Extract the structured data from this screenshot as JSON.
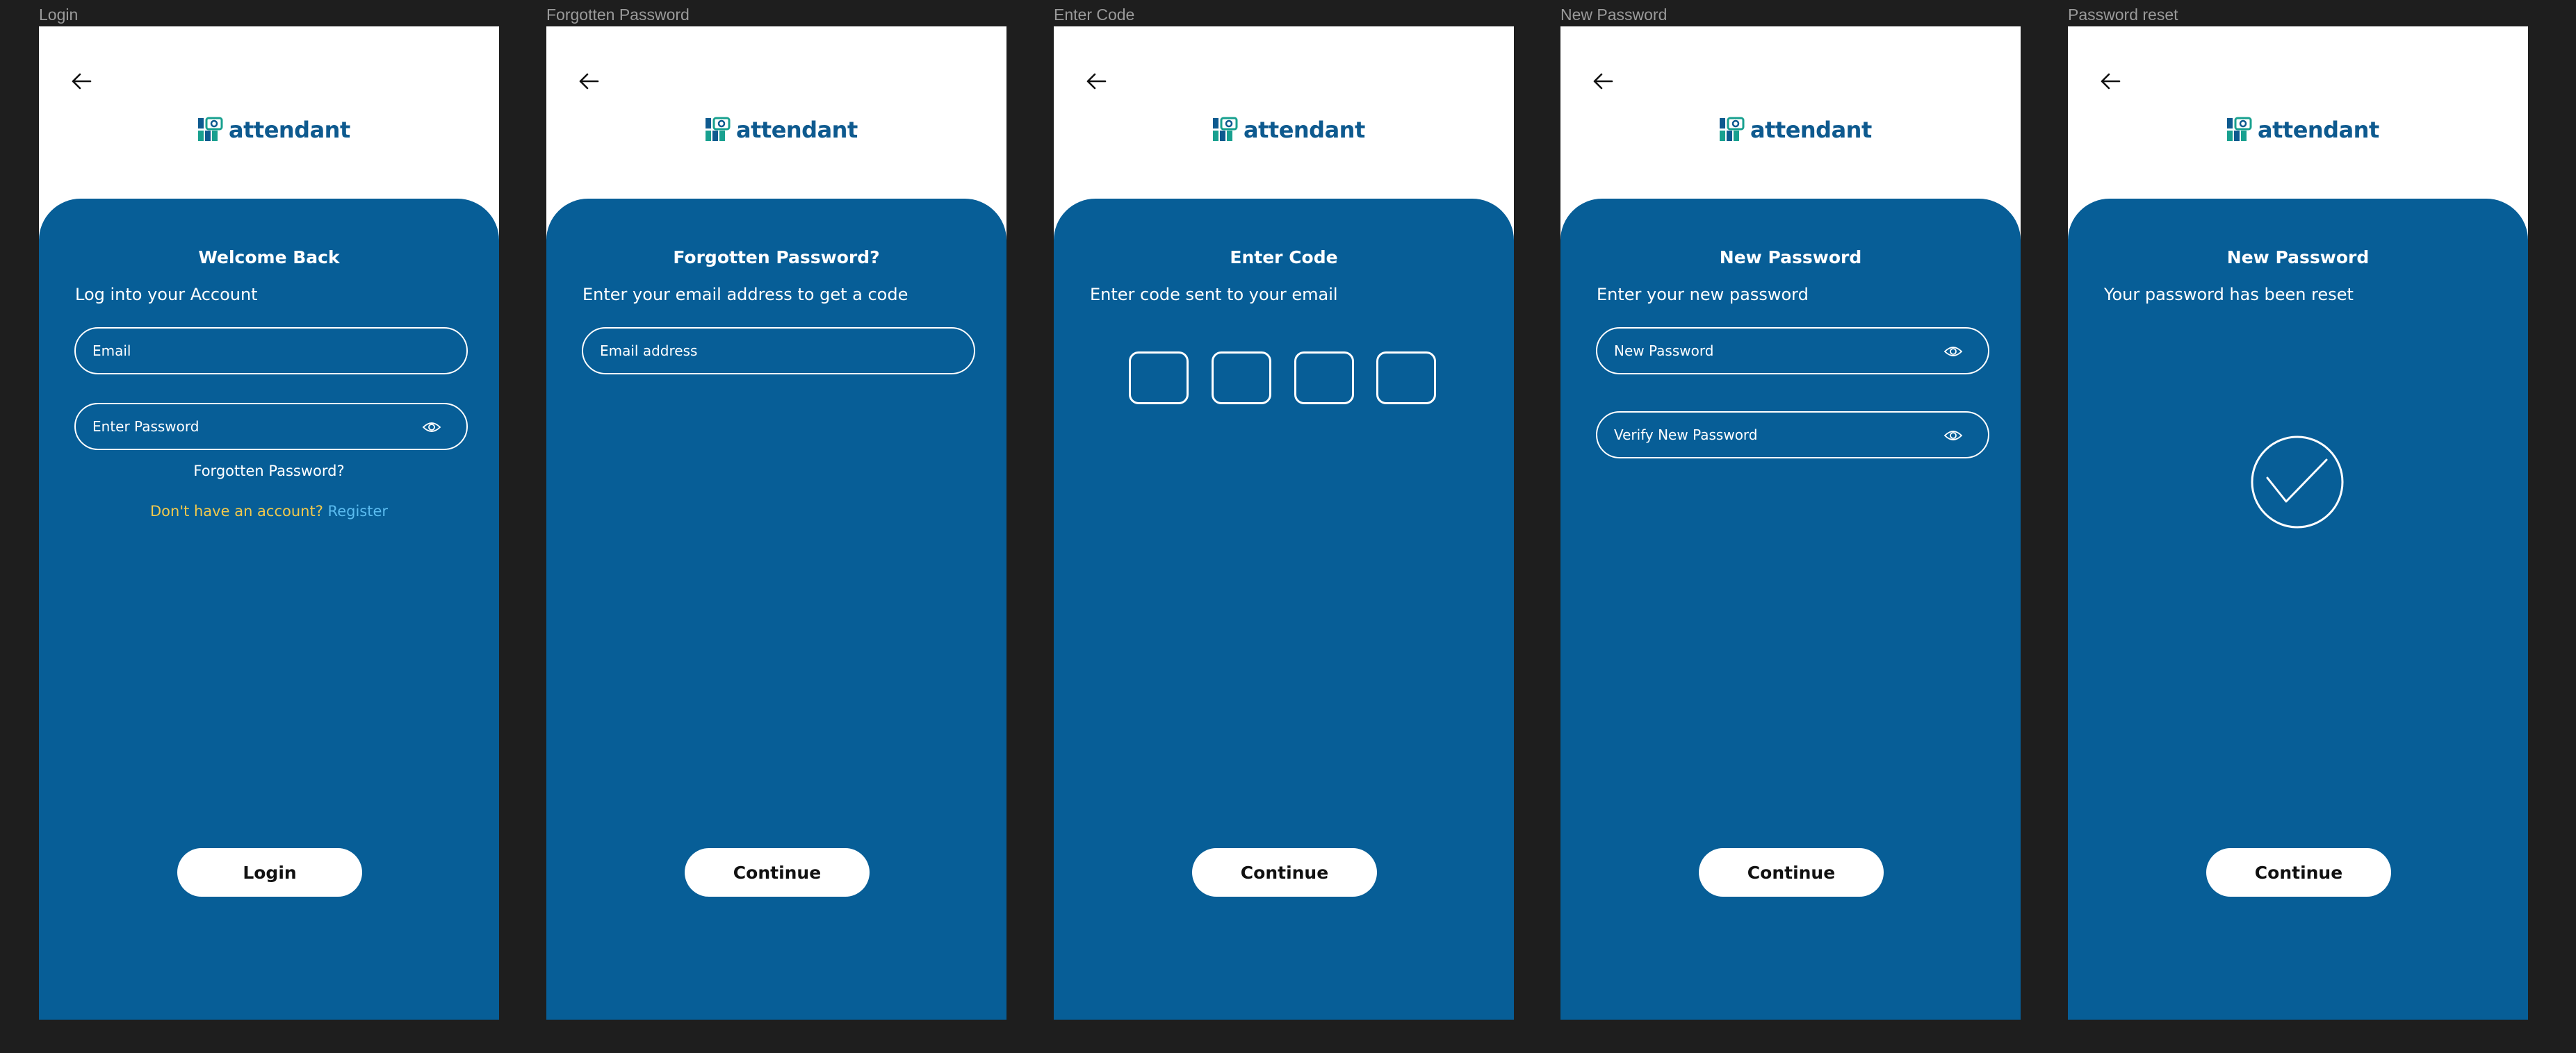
{
  "brand": {
    "name": "attendant",
    "color": "#0e5a8f",
    "panel_color": "#075e97"
  },
  "frames": [
    {
      "label": "Login",
      "title": "Welcome Back",
      "subtitle": "Log into your Account",
      "email_placeholder": "Email",
      "password_placeholder": "Enter Password",
      "forgot_link": "Forgotten Password?",
      "register_prompt": "Don't have an account?",
      "register_link": "Register",
      "button": "Login"
    },
    {
      "label": "Forgotten Password",
      "title": "Forgotten Password?",
      "subtitle": "Enter your email address to get a code",
      "email_placeholder": "Email address",
      "button": "Continue"
    },
    {
      "label": "Enter Code",
      "title": "Enter Code",
      "subtitle": "Enter code sent to your email",
      "button": "Continue"
    },
    {
      "label": "New Password",
      "title": "New Password",
      "subtitle": "Enter your new password",
      "new_password_placeholder": "New Password",
      "verify_password_placeholder": "Verify New Password",
      "button": "Continue"
    },
    {
      "label": "Password reset",
      "title": "New Password",
      "subtitle": "Your password has been reset",
      "button": "Continue"
    }
  ]
}
